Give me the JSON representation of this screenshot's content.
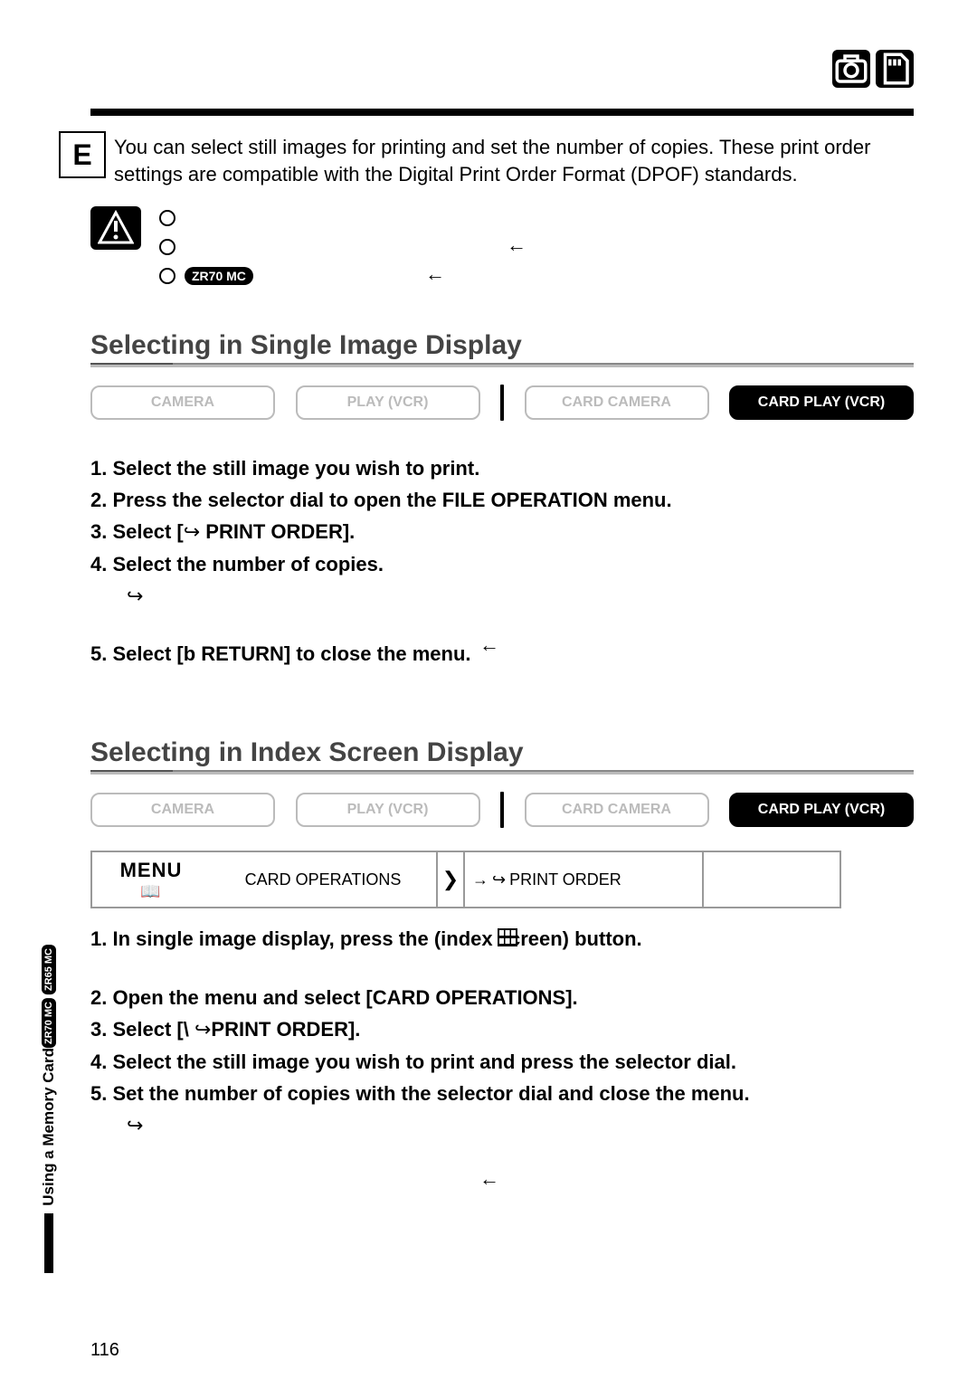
{
  "lang_letter": "E",
  "intro": "You can select still images for printing and set the number of copies. These print order settings are compatible with the Digital Print Order Format (DPOF) standards.",
  "caution": {
    "model_badge": "ZR70 MC"
  },
  "section1": {
    "heading": "Selecting in Single Image Display",
    "modes": [
      "CAMERA",
      "PLAY (VCR)",
      "CARD CAMERA",
      "CARD PLAY (VCR)"
    ],
    "steps": {
      "s1": "1. Select the still image you wish to print.",
      "s2": "2. Press the selector dial to open the FILE OPERATION menu.",
      "s3a": "3. Select [",
      "s3b": " PRINT ORDER].",
      "s4": "4. Select the number of copies.",
      "s5": "5. Select [b  RETURN] to close the menu."
    }
  },
  "section2": {
    "heading": "Selecting in Index Screen Display",
    "modes": [
      "CAMERA",
      "PLAY (VCR)",
      "CARD CAMERA",
      "CARD PLAY (VCR)"
    ],
    "menu": {
      "label": "MENU",
      "item1": "CARD OPERATIONS",
      "item2": "PRINT ORDER"
    },
    "steps": {
      "s1": "1. In single image display, press the        (index screen) button.",
      "s2": "2. Open the menu and select [CARD OPERATIONS].",
      "s3a": "3. Select [\\  ",
      "s3b": "PRINT ORDER].",
      "s4": "4. Select the still image you wish to print and press the selector dial.",
      "s5": "5. Set the number of copies with the selector dial and close the menu."
    }
  },
  "side": {
    "text": "Using a Memory Card",
    "badge1": "ZR70 MC",
    "badge2": "ZR65 MC"
  },
  "page_number": "116"
}
